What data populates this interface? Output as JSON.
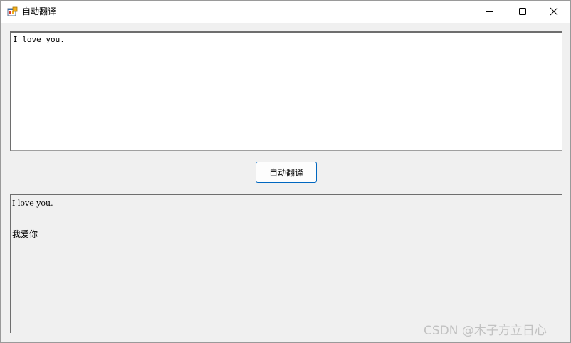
{
  "window": {
    "title": "自动翻译",
    "icon": "app-window-icon",
    "controls": {
      "minimize": "minimize-icon",
      "maximize": "maximize-icon",
      "close": "close-icon"
    }
  },
  "input": {
    "value": "I love you."
  },
  "translate_button": {
    "label": "自动翻译"
  },
  "output": {
    "source_line": "I love you.",
    "translated_line": "我爱你"
  },
  "watermark": {
    "text": "CSDN @木子方立日心"
  },
  "colors": {
    "button_border": "#0067c0",
    "window_bg": "#f0f0f0",
    "textbox_bg": "#ffffff"
  }
}
